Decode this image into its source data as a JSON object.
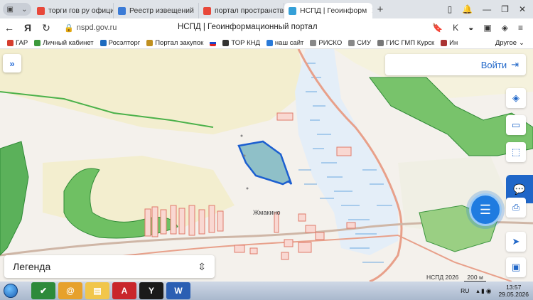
{
  "tabs": [
    {
      "label": "торги гов ру официал",
      "color": "#e8483a"
    },
    {
      "label": "Реестр извещений",
      "color": "#3b7bd6"
    },
    {
      "label": "портал пространств",
      "color": "#e8483a"
    },
    {
      "label": "НСПД | Геоинформ",
      "color": "#35a0d8"
    }
  ],
  "address": {
    "url": "nspd.gov.ru",
    "page_title": "НСПД | Геоинформационный портал"
  },
  "bookmarks": [
    {
      "label": "ГАР",
      "color": "#d63d2e"
    },
    {
      "label": "Личный кабинет",
      "color": "#3c9a3c"
    },
    {
      "label": "Росэлторг",
      "color": "#1d6bbf"
    },
    {
      "label": "Портал закупок",
      "color": "#c09020"
    },
    {
      "label": "",
      "color": "#d22"
    },
    {
      "label": "ТОР КНД",
      "color": "#333"
    },
    {
      "label": "наш сайт",
      "color": "#2a7ad8"
    },
    {
      "label": "РИСКО",
      "color": "#888"
    },
    {
      "label": "СИУ",
      "color": "#888"
    },
    {
      "label": "ГИС ГМП Курск",
      "color": "#777"
    },
    {
      "label": "Ин",
      "color": "#a33"
    }
  ],
  "bookmarks_more": "Другое",
  "map": {
    "login_label": "Войти",
    "legend_label": "Легенда",
    "place_label": "Жмакино",
    "attribution": "НСПД 2026",
    "scale_label": "200 м"
  },
  "taskbar": {
    "lang": "RU",
    "time": "13:57",
    "date": "29.05.2026"
  }
}
